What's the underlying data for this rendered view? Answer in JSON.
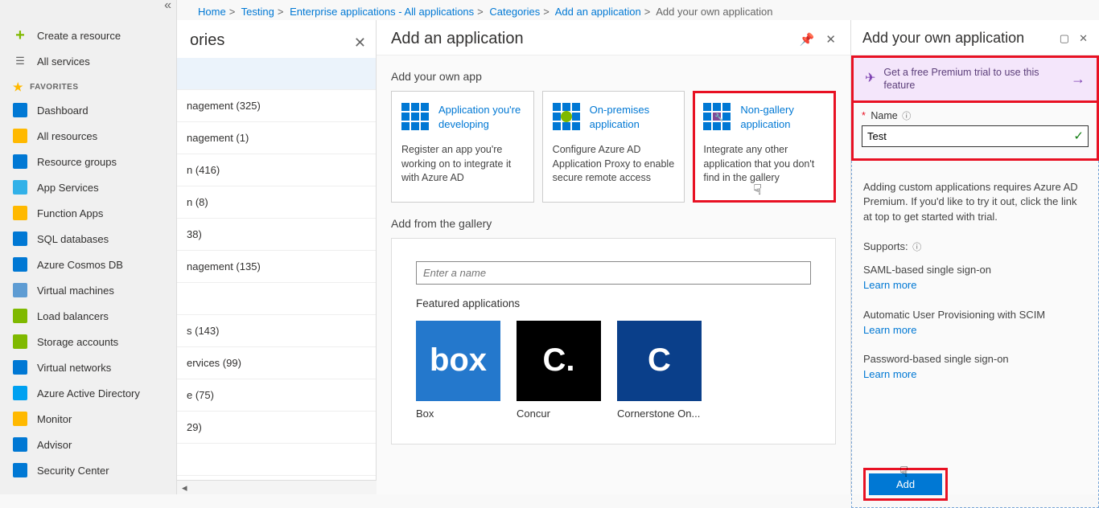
{
  "breadcrumb": {
    "items": [
      {
        "label": "Home"
      },
      {
        "label": "Testing"
      },
      {
        "label": "Enterprise applications - All applications"
      },
      {
        "label": "Categories"
      },
      {
        "label": "Add an application"
      }
    ],
    "current": "Add your own application"
  },
  "sidebar": {
    "create": "Create a resource",
    "all_services": "All services",
    "favorites_label": "FAVORITES",
    "items": [
      {
        "label": "Dashboard",
        "color": "#0078d4"
      },
      {
        "label": "All resources",
        "color": "#ffb900"
      },
      {
        "label": "Resource groups",
        "color": "#0078d4"
      },
      {
        "label": "App Services",
        "color": "#32b1e8"
      },
      {
        "label": "Function Apps",
        "color": "#ffb900"
      },
      {
        "label": "SQL databases",
        "color": "#0078d4"
      },
      {
        "label": "Azure Cosmos DB",
        "color": "#0078d4"
      },
      {
        "label": "Virtual machines",
        "color": "#5e9cd3"
      },
      {
        "label": "Load balancers",
        "color": "#7fb900"
      },
      {
        "label": "Storage accounts",
        "color": "#7fb900"
      },
      {
        "label": "Virtual networks",
        "color": "#0078d4"
      },
      {
        "label": "Azure Active Directory",
        "color": "#00a1f1"
      },
      {
        "label": "Monitor",
        "color": "#ffb900"
      },
      {
        "label": "Advisor",
        "color": "#0078d4"
      },
      {
        "label": "Security Center",
        "color": "#0078d4"
      }
    ]
  },
  "categories": {
    "title_suffix": "ories",
    "items": [
      {
        "label": ""
      },
      {
        "label": "nagement (325)"
      },
      {
        "label": "nagement (1)"
      },
      {
        "label": "n (416)"
      },
      {
        "label": "n (8)"
      },
      {
        "label": "38)"
      },
      {
        "label": "nagement (135)"
      },
      {
        "label": ""
      },
      {
        "label": "s (143)"
      },
      {
        "label": "ervices (99)"
      },
      {
        "label": "e (75)"
      },
      {
        "label": "29)"
      },
      {
        "label": ""
      }
    ]
  },
  "main": {
    "title": "Add an application",
    "own_app_title": "Add your own app",
    "tiles": [
      {
        "title": "Application you're developing",
        "desc": "Register an app you're working on to integrate it with Azure AD"
      },
      {
        "title": "On-premises application",
        "desc": "Configure Azure AD Application Proxy to enable secure remote access"
      },
      {
        "title": "Non-gallery application",
        "desc": "Integrate any other application that you don't find in the gallery"
      }
    ],
    "gallery_title": "Add from the gallery",
    "search_placeholder": "Enter a name",
    "featured_title": "Featured applications",
    "apps": [
      {
        "name": "Box",
        "bg": "#2478cc",
        "glyph": "box"
      },
      {
        "name": "Concur",
        "bg": "#000000",
        "glyph": "C."
      },
      {
        "name": "Cornerstone On...",
        "bg": "#0a3f8a",
        "glyph": "C"
      }
    ]
  },
  "right": {
    "title": "Add your own application",
    "trial_text": "Get a free Premium trial to use this feature",
    "name_label": "Name",
    "name_value": "Test",
    "helper_text": "Adding custom applications requires Azure AD Premium. If you'd like to try it out, click the link at top to get started with trial.",
    "supports_label": "Supports:",
    "supports": [
      {
        "text": "SAML-based single sign-on",
        "link": "Learn more"
      },
      {
        "text": "Automatic User Provisioning with SCIM",
        "link": "Learn more"
      },
      {
        "text": "Password-based single sign-on",
        "link": "Learn more"
      }
    ],
    "add_label": "Add"
  }
}
